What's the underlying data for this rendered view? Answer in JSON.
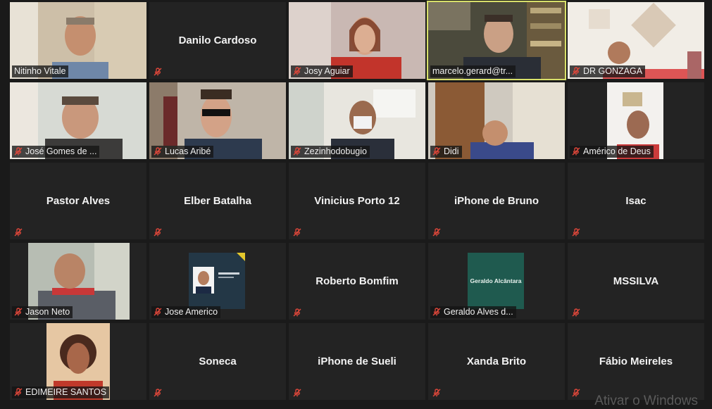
{
  "participants": [
    {
      "name": "Nitinho Vitale",
      "muted": false,
      "video": true,
      "scene": "a"
    },
    {
      "name": "Danilo Cardoso",
      "muted": true,
      "video": false
    },
    {
      "name": "Josy Aguiar",
      "muted": true,
      "video": true,
      "scene": "b"
    },
    {
      "name": "marcelo.gerard@tr...",
      "muted": false,
      "video": true,
      "scene": "c",
      "active": true
    },
    {
      "name": "DR GONZAGA",
      "muted": true,
      "video": true,
      "scene": "d"
    },
    {
      "name": "José Gomes de ...",
      "muted": true,
      "video": true,
      "scene": "e"
    },
    {
      "name": "Lucas Aribé",
      "muted": true,
      "video": true,
      "scene": "f"
    },
    {
      "name": "Zezinhodobugio",
      "muted": true,
      "video": true,
      "scene": "g"
    },
    {
      "name": "Didi",
      "muted": true,
      "video": true,
      "scene": "h"
    },
    {
      "name": "Américo de Deus",
      "muted": true,
      "video": true,
      "scene": "i"
    },
    {
      "name": "Pastor Alves",
      "muted": true,
      "video": false
    },
    {
      "name": "Elber Batalha",
      "muted": true,
      "video": false
    },
    {
      "name": "Vinicius Porto 12",
      "muted": true,
      "video": false
    },
    {
      "name": "iPhone de Bruno",
      "muted": true,
      "video": false
    },
    {
      "name": "Isac",
      "muted": true,
      "video": false
    },
    {
      "name": "Jason Neto",
      "muted": true,
      "video": true,
      "scene": "j"
    },
    {
      "name": "Jose Americo",
      "muted": true,
      "video": true,
      "scene": "k"
    },
    {
      "name": "Roberto Bomfim",
      "muted": true,
      "video": false
    },
    {
      "name": "Geraldo Alves d...",
      "muted": true,
      "video": true,
      "scene": "l",
      "card_text": "Geraldo Alcântara"
    },
    {
      "name": "MSSILVA",
      "muted": true,
      "video": false
    },
    {
      "name": "EDIMEIRE SANTOS",
      "muted": true,
      "video": true,
      "scene": "m"
    },
    {
      "name": "Soneca",
      "muted": true,
      "video": false
    },
    {
      "name": "iPhone de Sueli",
      "muted": true,
      "video": false
    },
    {
      "name": "Xanda Brito",
      "muted": true,
      "video": false
    },
    {
      "name": "Fábio Meireles",
      "muted": true,
      "video": false
    }
  ],
  "watermark": "Ativar o Windows",
  "colors": {
    "active_border": "#d8e06a",
    "muted_icon": "#e0473a",
    "tile_bg": "#232323"
  }
}
